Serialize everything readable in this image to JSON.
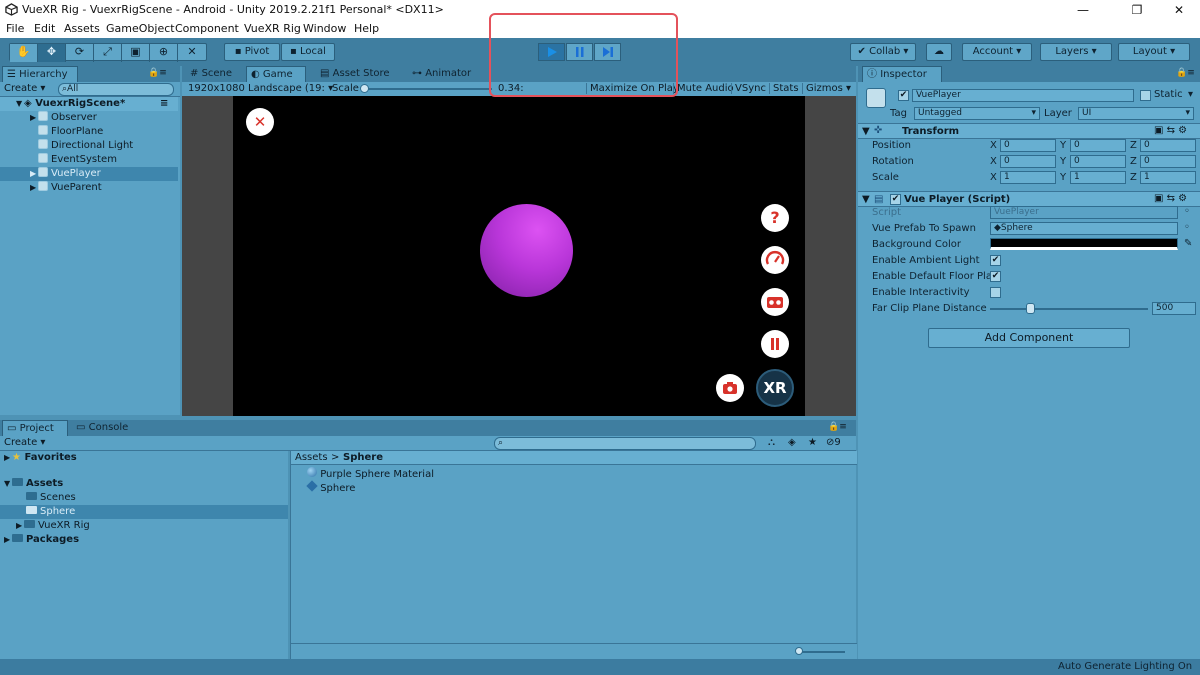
{
  "window": {
    "title": "VueXR Rig - VuexrRigScene - Android - Unity 2019.2.21f1 Personal* <DX11>"
  },
  "menu": [
    "File",
    "Edit",
    "Assets",
    "GameObject",
    "Component",
    "VueXR Rig",
    "Window",
    "Help"
  ],
  "toolbar": {
    "pivot": "Pivot",
    "local": "Local",
    "collab": "Collab",
    "account": "Account",
    "layers": "Layers",
    "layout": "Layout"
  },
  "hierarchy": {
    "tab": "Hierarchy",
    "create": "Create",
    "search_placeholder": "All",
    "scene": "VuexrRigScene*",
    "items": [
      "Observer",
      "FloorPlane",
      "Directional Light",
      "EventSystem",
      "VuePlayer",
      "VueParent"
    ]
  },
  "center_tabs": [
    "Scene",
    "Game",
    "Asset Store",
    "Animator"
  ],
  "game_bar": {
    "resolution": "1920x1080 Landscape (19:",
    "scale_label": "Scale",
    "scale_value": "0.34:",
    "maximize": "Maximize On Play",
    "mute": "Mute Audio",
    "vsync": "VSync",
    "stats": "Stats",
    "gizmos": "Gizmos"
  },
  "colors": {
    "sphere": "#b936d9",
    "highlight": "#e4525b",
    "accent": "#2b73a3"
  },
  "project": {
    "tabs": [
      "Project",
      "Console"
    ],
    "create": "Create",
    "tree": {
      "favorites": "Favorites",
      "assets": "Assets",
      "scenes": "Scenes",
      "sphere": "Sphere",
      "vuexr": "VueXR Rig",
      "packages": "Packages"
    },
    "breadcrumb": [
      "Assets",
      "Sphere"
    ],
    "files": [
      "Purple Sphere Material",
      "Sphere"
    ],
    "count": "9"
  },
  "inspector": {
    "tab": "Inspector",
    "object_name": "VuePlayer",
    "static": "Static",
    "tag_label": "Tag",
    "tag": "Untagged",
    "layer_label": "Layer",
    "layer": "UI",
    "transform": {
      "title": "Transform",
      "rows": [
        {
          "label": "Position",
          "x": "0",
          "y": "0",
          "z": "0"
        },
        {
          "label": "Rotation",
          "x": "0",
          "y": "0",
          "z": "0"
        },
        {
          "label": "Scale",
          "x": "1",
          "y": "1",
          "z": "1"
        }
      ]
    },
    "script": {
      "title": "Vue Player (Script)",
      "script_label": "Script",
      "script_value": "VuePlayer",
      "prefab_label": "Vue Prefab To Spawn",
      "prefab_value": "Sphere",
      "bg_label": "Background Color",
      "ambient_label": "Enable Ambient Light",
      "floor_label": "Enable Default Floor Pla",
      "interact_label": "Enable Interactivity",
      "clip_label": "Far Clip Plane Distance",
      "clip_value": "500"
    },
    "add_component": "Add Component"
  },
  "status": {
    "text": "Auto Generate Lighting On"
  }
}
